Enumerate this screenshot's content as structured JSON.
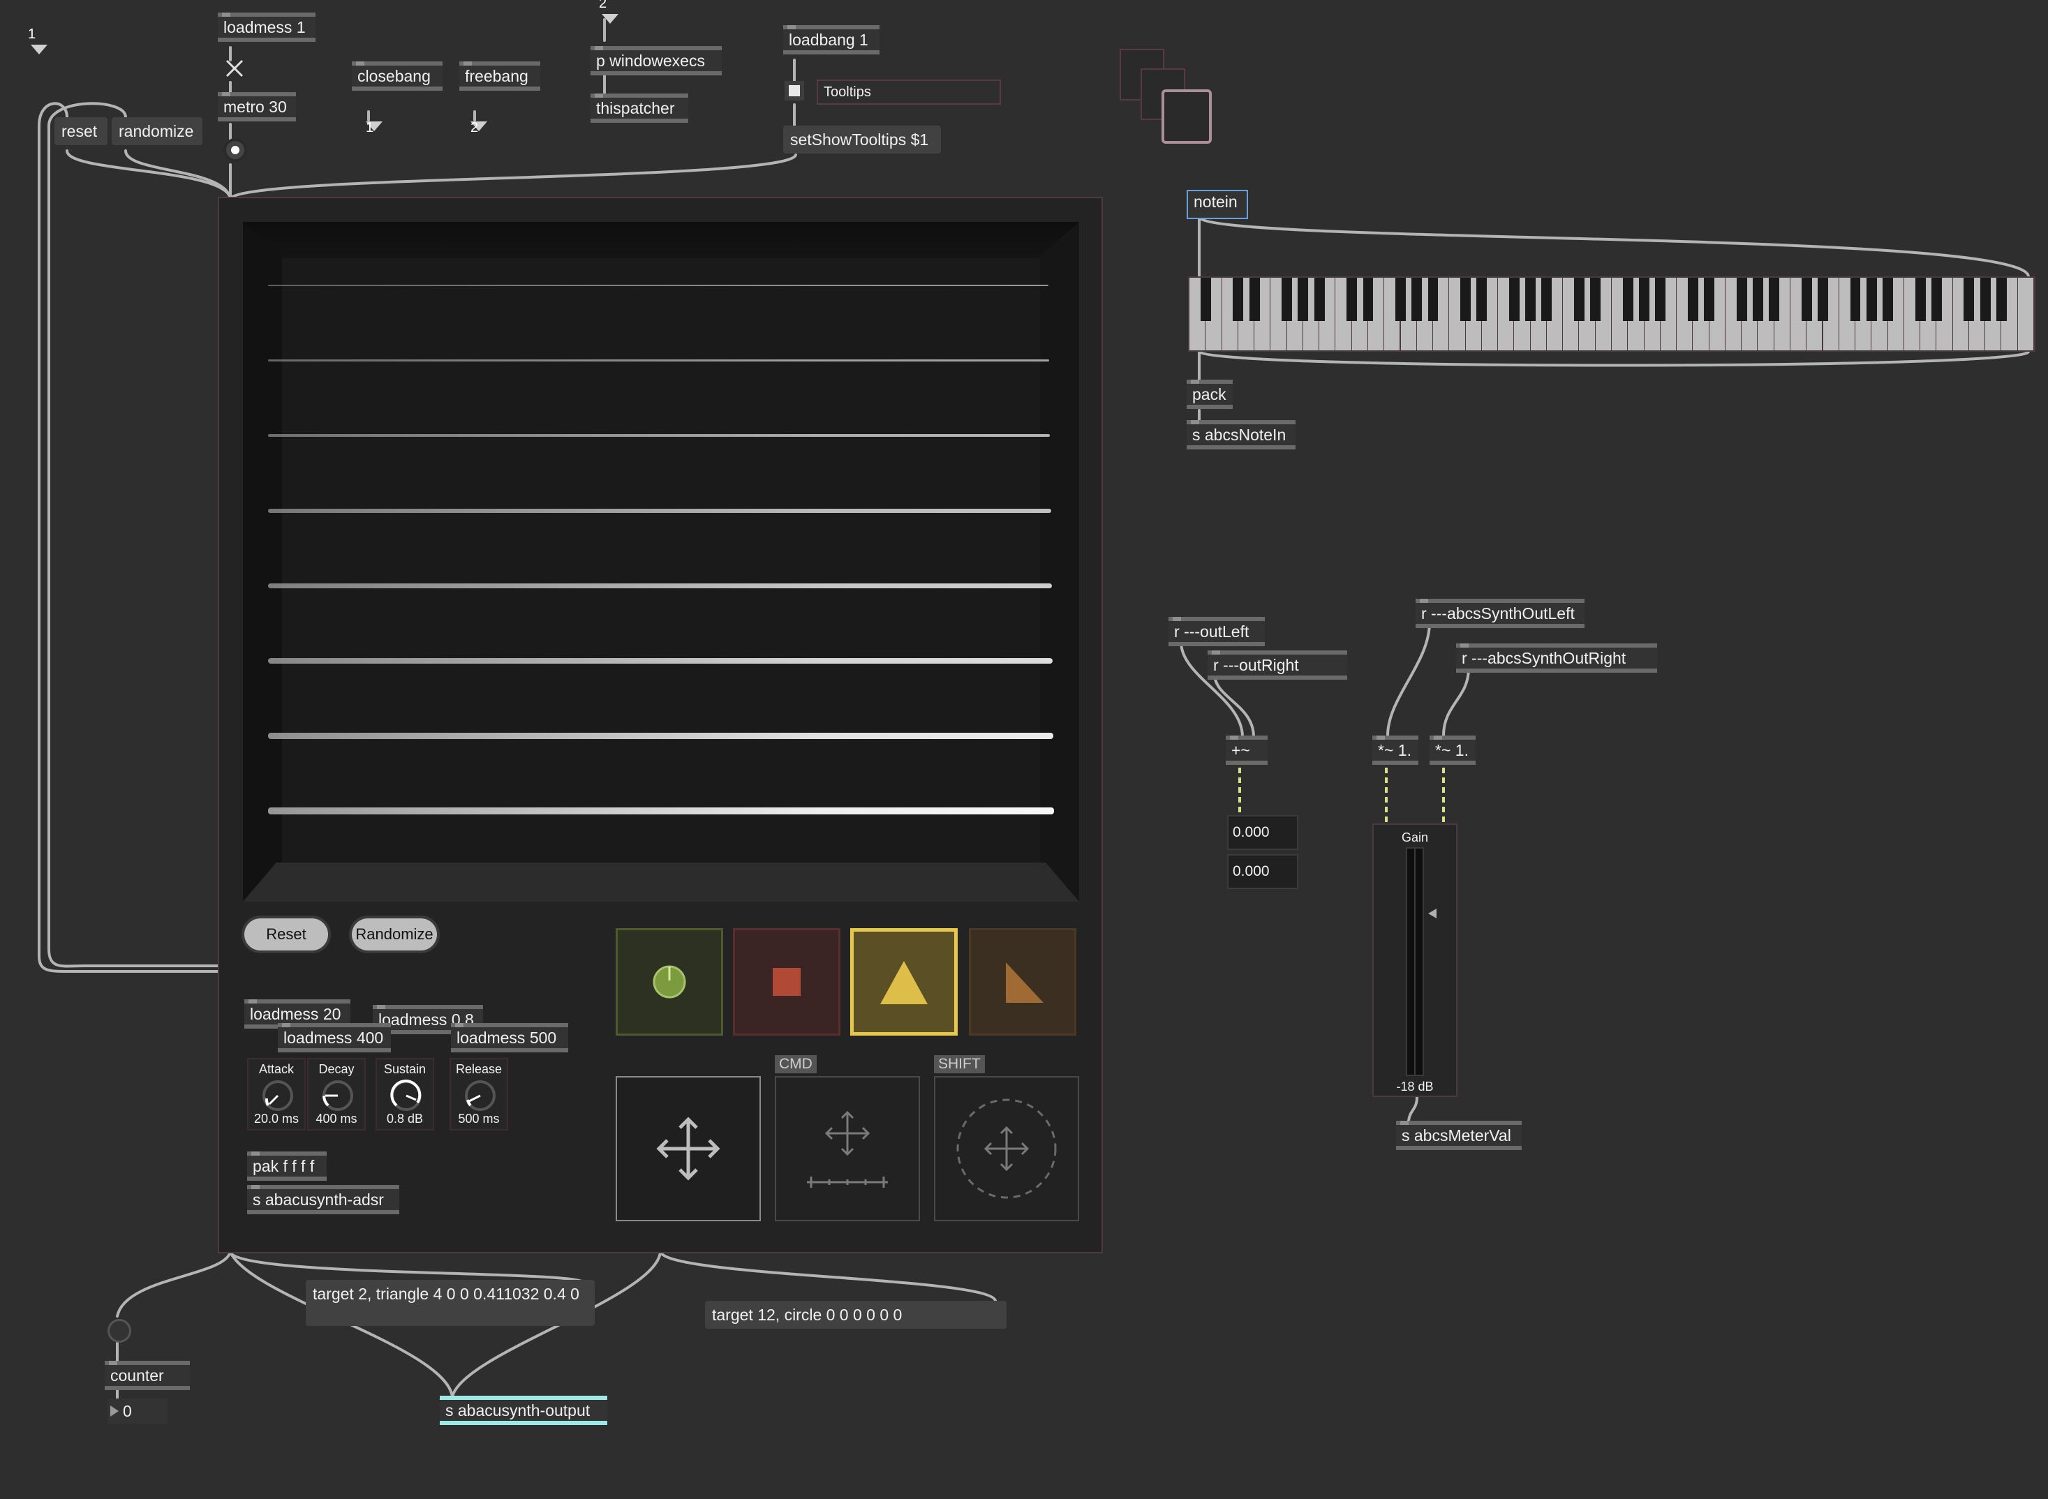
{
  "top": {
    "number_1": "1",
    "number_2_top": "2"
  },
  "objects": {
    "loadmess_1": "loadmess 1",
    "metro": "metro 30",
    "closebang": "closebang",
    "freebang": "freebang",
    "closebang_out": "1",
    "freebang_out": "2",
    "windowexecs": "p windowexecs",
    "thispatcher": "thispatcher",
    "loadbang": "loadbang 1",
    "tooltips_label": "Tooltips",
    "set_tooltips": "setShowTooltips $1",
    "reset_msg": "reset",
    "randomize_msg": "randomize",
    "notein": "notein",
    "pack": "pack",
    "send_notein": "s abcsNoteIn",
    "r_outleft": "r ---outLeft",
    "r_outright": "r ---outRight",
    "plus_tilde": "+~",
    "r_synth_left": "r ---abcsSynthOutLeft",
    "r_synth_right": "r ---abcsSynthOutRight",
    "mult_left": "*~ 1.",
    "mult_right": "*~ 1.",
    "num_left": "0.000",
    "num_right": "0.000",
    "gain_label": "Gain",
    "gain_value": "-18 dB",
    "send_meter": "s abcsMeterVal",
    "target_triangle": "target 2, triangle 4 0 0 0.411032 0.4 0",
    "target_circle": "target 12, circle 0 0 0 0 0 0",
    "counter": "counter",
    "counter_value": "0",
    "send_output": "s abacusynth-output"
  },
  "bpatcher": {
    "reset_btn": "Reset",
    "randomize_btn": "Randomize",
    "loadmess_attack": "loadmess 20",
    "loadmess_decay": "loadmess 400",
    "loadmess_sustain": "loadmess 0.8",
    "loadmess_release": "loadmess 500",
    "knobs": [
      {
        "label": "Attack",
        "value": "20.0 ms"
      },
      {
        "label": "Decay",
        "value": "400 ms"
      },
      {
        "label": "Sustain",
        "value": "0.8 dB"
      },
      {
        "label": "Release",
        "value": "500 ms"
      }
    ],
    "pak": "pak f f f f",
    "send_adsr": "s abacusynth-adsr",
    "pad_cmd": "CMD",
    "pad_shift": "SHIFT",
    "shape_selected": "triangle",
    "shapes": [
      "sine-circle",
      "square",
      "triangle",
      "saw"
    ]
  },
  "colors": {
    "background": "#2e2e2e",
    "object_bg": "#333333",
    "wire": "#b5b5b5",
    "signal_wire": "#d9e08a",
    "accent_yellow": "#e8c84a",
    "send_highlight": "#9fe8e8"
  }
}
